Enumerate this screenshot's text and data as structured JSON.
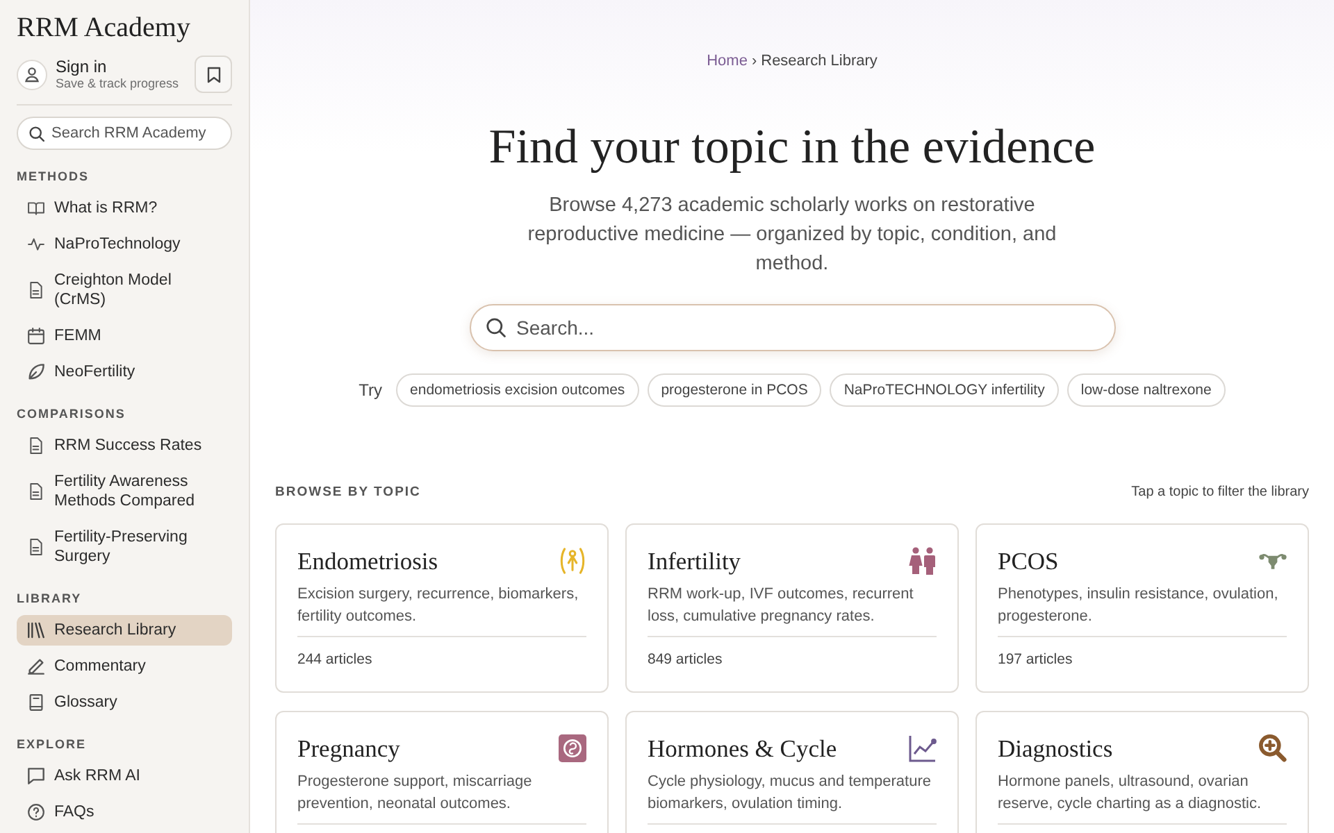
{
  "sidebar": {
    "title": "RRM Academy",
    "account": {
      "label": "Sign in",
      "sublabel": "Save & track progress"
    },
    "search": {
      "placeholder": "Search RRM Academy"
    },
    "sections": [
      {
        "heading": "METHODS",
        "items": [
          {
            "label": "What is RRM?",
            "selected": false
          },
          {
            "label": "NaProTechnology",
            "selected": false
          },
          {
            "label": "Creighton Model (CrMS)",
            "selected": false
          },
          {
            "label": "FEMM",
            "selected": false
          },
          {
            "label": "NeoFertility",
            "selected": false
          }
        ]
      },
      {
        "heading": "COMPARISONS",
        "items": [
          {
            "label": "RRM Success Rates",
            "selected": false
          },
          {
            "label": "Fertility Awareness Methods Compared",
            "selected": false
          },
          {
            "label": "Fertility-Preserving Surgery",
            "selected": false
          }
        ]
      },
      {
        "heading": "LIBRARY",
        "items": [
          {
            "label": "Research Library",
            "selected": true
          },
          {
            "label": "Commentary",
            "selected": false
          },
          {
            "label": "Glossary",
            "selected": false
          }
        ]
      },
      {
        "heading": "EXPLORE",
        "items": [
          {
            "label": "Ask RRM AI",
            "selected": false
          },
          {
            "label": "FAQs",
            "selected": false
          }
        ]
      }
    ]
  },
  "breadcrumb": {
    "separator": "›",
    "items": [
      {
        "label": "Home",
        "kind": "link"
      },
      {
        "label": "Research Library",
        "kind": "current"
      }
    ]
  },
  "hero": {
    "title": "Find your topic in the evidence",
    "subtitle": "Browse 4,273 academic scholarly works on restorative reproductive medicine — organized by topic, condition, and method.",
    "search": {
      "placeholder": "Search..."
    },
    "try_label": "Try",
    "suggestions": [
      "endometriosis excision outcomes",
      "progesterone in PCOS",
      "NaProTECHNOLOGY infertility",
      "low-dose naltrexone"
    ]
  },
  "topics": {
    "heading": "BROWSE BY TOPIC",
    "hint": "Tap a topic to filter the library",
    "cards": [
      {
        "title": "Endometriosis",
        "description": "Excision surgery, recurrence, biomarkers, fertility outcomes.",
        "count": "244 articles",
        "color": "#e6b52a"
      },
      {
        "title": "Infertility",
        "description": "RRM work-up, IVF outcomes, recurrent loss, cumulative pregnancy rates.",
        "count": "849 articles",
        "color": "#a5607a"
      },
      {
        "title": "PCOS",
        "description": "Phenotypes, insulin resistance, ovulation, progesterone.",
        "count": "197 articles",
        "color": "#7d8b70"
      },
      {
        "title": "Pregnancy",
        "description": "Progesterone support, miscarriage prevention, neonatal outcomes.",
        "color": "#a9687f"
      },
      {
        "title": "Hormones & Cycle",
        "description": "Cycle physiology, mucus and temperature biomarkers, ovulation timing.",
        "color": "#6d5a8e"
      },
      {
        "title": "Diagnostics",
        "description": "Hormone panels, ultrasound, ovarian reserve, cycle charting as a diagnostic.",
        "color": "#8a5a2e"
      }
    ]
  }
}
